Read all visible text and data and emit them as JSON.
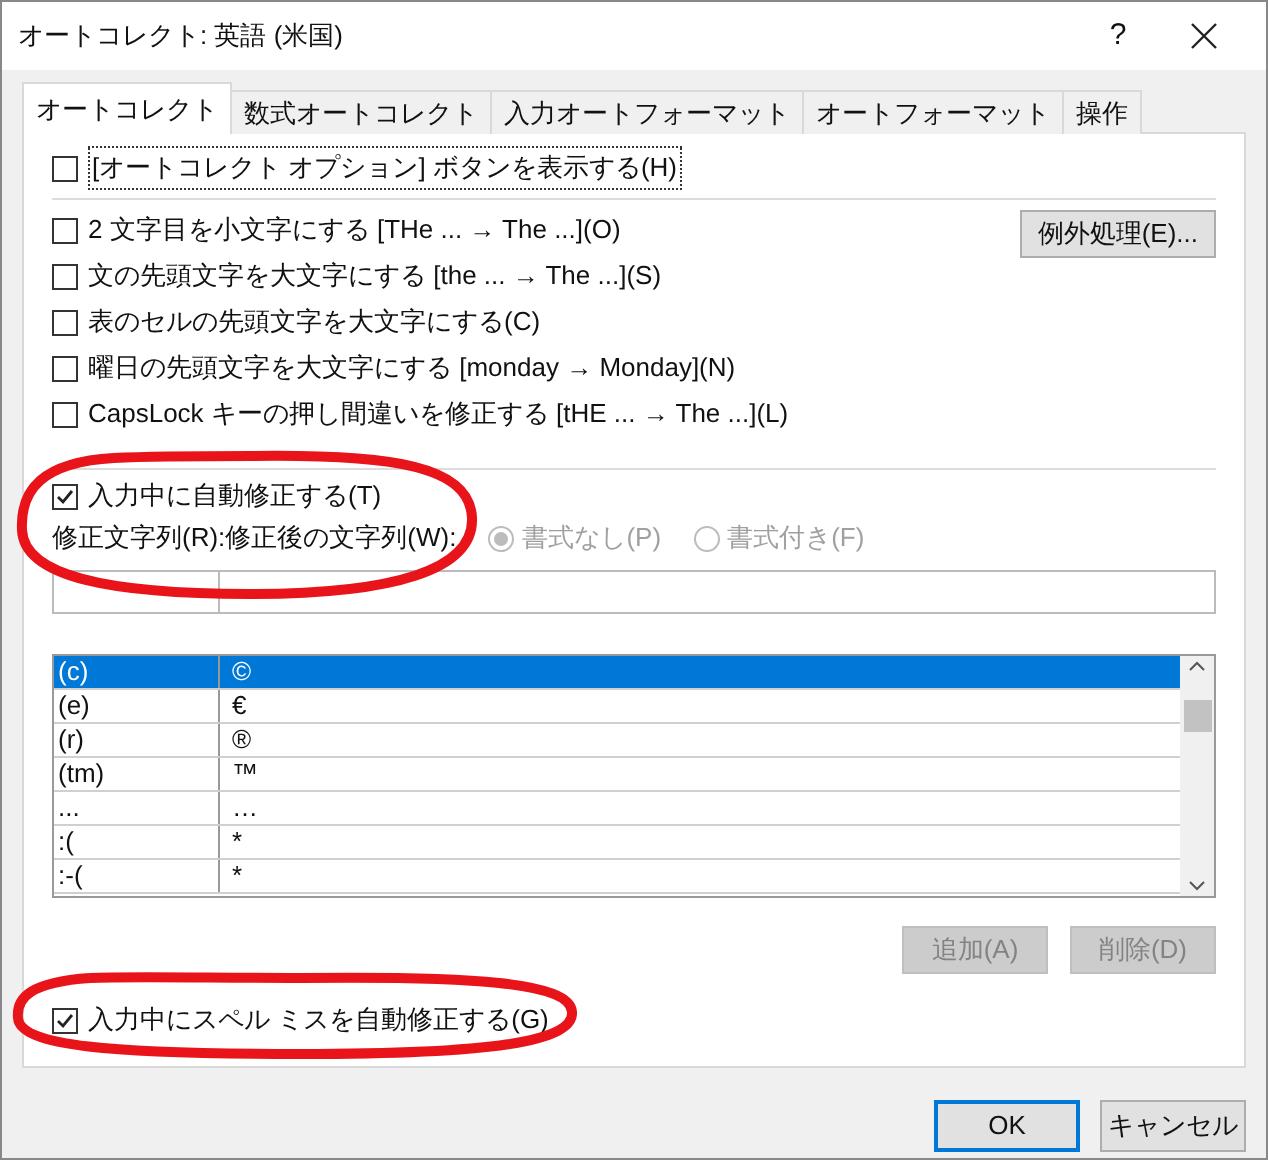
{
  "window": {
    "title": "オートコレクト: 英語 (米国)",
    "help": "?"
  },
  "tabs": [
    {
      "label": "オートコレクト",
      "selected": true
    },
    {
      "label": "数式オートコレクト",
      "selected": false
    },
    {
      "label": "入力オートフォーマット",
      "selected": false
    },
    {
      "label": "オートフォーマット",
      "selected": false
    },
    {
      "label": "操作",
      "selected": false
    }
  ],
  "show_options": {
    "label": "[オートコレクト オプション] ボタンを表示する(H)",
    "checked": false
  },
  "options": [
    {
      "label": "2 文字目を小文字にする [THe ... → The ...](O)",
      "checked": false
    },
    {
      "label": "文の先頭文字を大文字にする [the ... → The ...](S)",
      "checked": false
    },
    {
      "label": "表のセルの先頭文字を大文字にする(C)",
      "checked": false
    },
    {
      "label": "曜日の先頭文字を大文字にする [monday →  Monday](N)",
      "checked": false
    },
    {
      "label": "CapsLock キーの押し間違いを修正する [tHE ... → The ...](L)",
      "checked": false
    }
  ],
  "exceptions_button": "例外処理(E)...",
  "replace_as_you_type": {
    "label": "入力中に自動修正する(T)",
    "checked": true
  },
  "replace_label": "修正文字列(R):",
  "with_label": "修正後の文字列(W):",
  "format_radios": [
    {
      "label": "書式なし(P)",
      "selected": true,
      "disabled": true
    },
    {
      "label": "書式付き(F)",
      "selected": false,
      "disabled": true
    }
  ],
  "entries": [
    {
      "from": "(c)",
      "to": "©",
      "selected": true
    },
    {
      "from": "(e)",
      "to": "€",
      "selected": false
    },
    {
      "from": "(r)",
      "to": "®",
      "selected": false
    },
    {
      "from": "(tm)",
      "to": "™",
      "selected": false
    },
    {
      "from": "...",
      "to": "…",
      "selected": false
    },
    {
      "from": ":(",
      "to": "*",
      "selected": false
    },
    {
      "from": ":-(",
      "to": "*",
      "selected": false
    }
  ],
  "entry_buttons": [
    {
      "label": "追加(A)",
      "disabled": true
    },
    {
      "label": "削除(D)",
      "disabled": true
    }
  ],
  "spelling": {
    "label": "入力中にスペル ミスを自動修正する(G)",
    "checked": true
  },
  "footer_buttons": [
    {
      "label": "OK",
      "kind": "default"
    },
    {
      "label": "キャンセル",
      "kind": "normal"
    }
  ]
}
